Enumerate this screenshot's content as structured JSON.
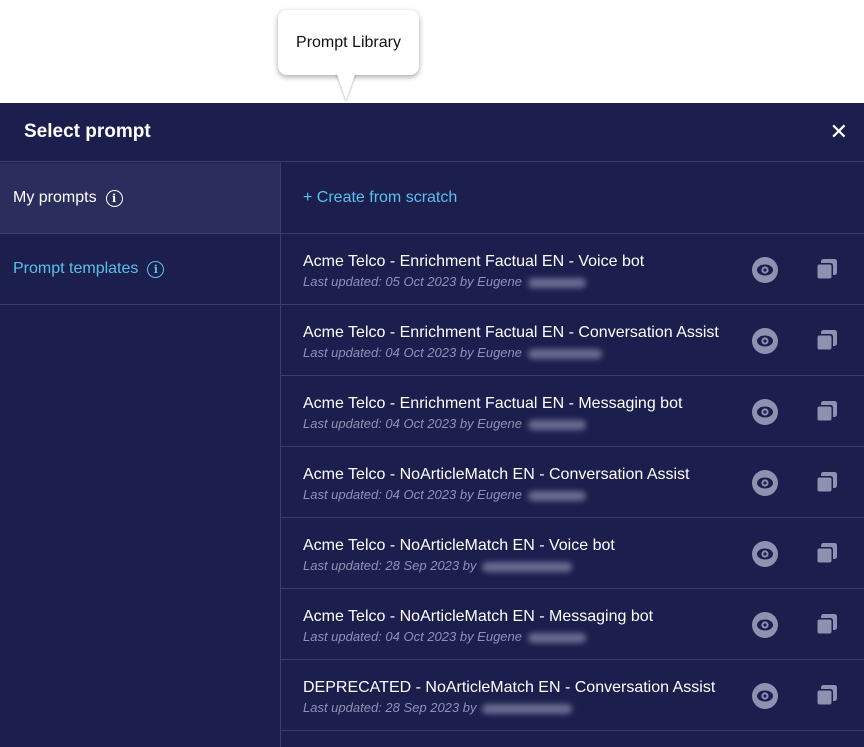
{
  "tooltip": {
    "text": "Prompt Library"
  },
  "header": {
    "title": "Select prompt",
    "close_icon": "close-icon"
  },
  "sidebar": {
    "items": [
      {
        "label": "My prompts",
        "icon": "info-icon"
      },
      {
        "label": "Prompt templates",
        "icon": "info-icon"
      }
    ]
  },
  "main": {
    "create_label": "+ Create from scratch",
    "prompts": [
      {
        "title": "Acme Telco - Enrichment Factual EN - Voice bot",
        "updated": "Last updated: 05 Oct 2023 by Eugene"
      },
      {
        "title": "Acme Telco - Enrichment Factual EN - Conversation Assist",
        "updated": "Last updated: 04 Oct 2023 by Eugene"
      },
      {
        "title": "Acme Telco - Enrichment Factual EN - Messaging bot",
        "updated": "Last updated: 04 Oct 2023 by Eugene"
      },
      {
        "title": "Acme Telco - NoArticleMatch EN - Conversation Assist",
        "updated": "Last updated: 04 Oct 2023 by Eugene"
      },
      {
        "title": "Acme Telco - NoArticleMatch EN - Voice bot",
        "updated": "Last updated: 28 Sep 2023 by"
      },
      {
        "title": "Acme Telco - NoArticleMatch EN - Messaging bot",
        "updated": "Last updated: 04 Oct 2023 by Eugene"
      },
      {
        "title": "DEPRECATED - NoArticleMatch EN - Conversation Assist",
        "updated": "Last updated: 28 Sep 2023 by"
      }
    ],
    "row_icons": [
      "eye-icon",
      "copy-icon"
    ]
  },
  "colors": {
    "panel_bg": "#1c1f4d",
    "accent_link": "#5bc0eb",
    "divider": "#3a3e6c",
    "icon_gray": "#8e92b0"
  }
}
